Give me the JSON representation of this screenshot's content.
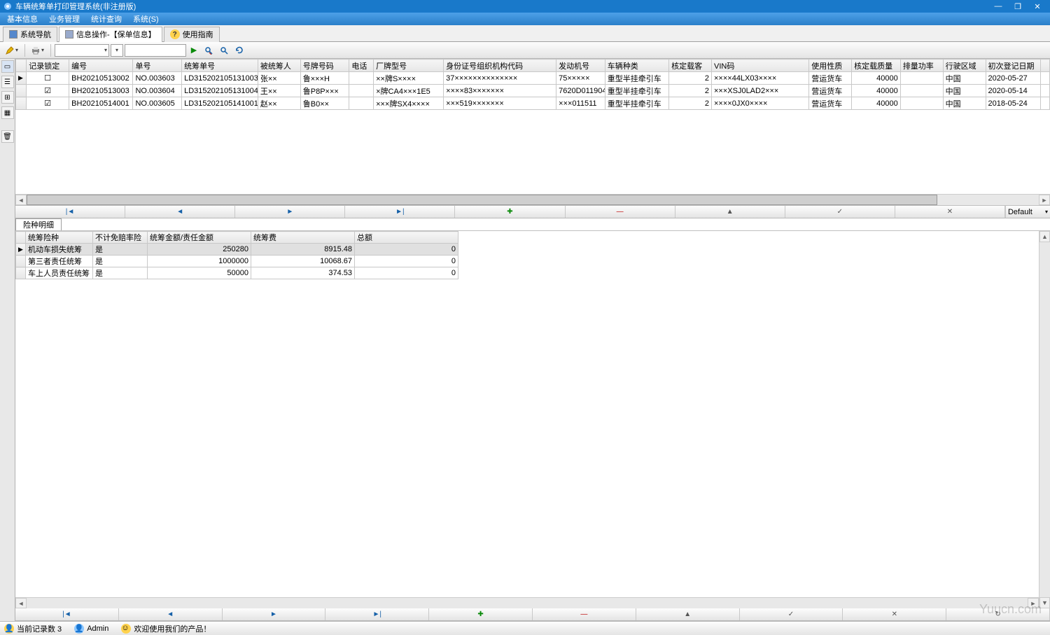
{
  "title": "车辆统筹单打印管理系统(非注册版)",
  "menu": [
    "基本信息",
    "业务管理",
    "统计查询",
    "系统(S)"
  ],
  "tabs": {
    "nav": "系统导航",
    "active": "信息操作-【保单信息】",
    "guide": "使用指南"
  },
  "toolbar": {
    "combo_text": "",
    "search_text": ""
  },
  "main_grid": {
    "columns": [
      "记录锁定",
      "编号",
      "单号",
      "统筹单号",
      "被统筹人",
      "号牌号码",
      "电话",
      "厂牌型号",
      "身份证号组织机构代码",
      "发动机号",
      "车辆种类",
      "核定载客",
      "VIN码",
      "使用性质",
      "核定载质量",
      "排量功率",
      "行驶区域",
      "初次登记日期"
    ],
    "rows": [
      {
        "lock": false,
        "no": "BH20210513002",
        "dan": "NO.003603",
        "tch": "LD315202105131003",
        "name": "张××",
        "plate": "鲁×××H",
        "phone": "",
        "model": "××牌S××××",
        "id": "37××××××××××××××",
        "eng": "75×××××",
        "type": "重型半挂牵引车",
        "seats": "2",
        "vin": "××××44LX03××××",
        "use": "营运货车",
        "mass": "40000",
        "power": "",
        "area": "中国",
        "date": "2020-05-27"
      },
      {
        "lock": true,
        "no": "BH20210513003",
        "dan": "NO.003604",
        "tch": "LD315202105131004",
        "name": "王××",
        "plate": "鲁P8P×××",
        "phone": "",
        "model": "×牌CA4×××1E5",
        "id": "××××83×××××××",
        "eng": "7620D011904",
        "type": "重型半挂牵引车",
        "seats": "2",
        "vin": "×××XSJ0LAD2×××",
        "use": "营运货车",
        "mass": "40000",
        "power": "",
        "area": "中国",
        "date": "2020-05-14"
      },
      {
        "lock": true,
        "no": "BH20210514001",
        "dan": "NO.003605",
        "tch": "LD315202105141001",
        "name": "赵××",
        "plate": "鲁B0××",
        "phone": "",
        "model": "×××牌SX4××××",
        "id": "×××519×××××××",
        "eng": "×××011511",
        "type": "重型半挂牵引车",
        "seats": "2",
        "vin": "××××0JX0××××",
        "use": "营运货车",
        "mass": "40000",
        "power": "",
        "area": "中国",
        "date": "2018-05-24"
      }
    ]
  },
  "nav_default": "Default",
  "detail_tab": "险种明细",
  "detail_grid": {
    "columns": [
      "统筹险种",
      "不计免赔率险",
      "统筹金额/责任金额",
      "统筹费",
      "总额"
    ],
    "rows": [
      {
        "kind": "机动车损失统筹",
        "nodeduct": "是",
        "amount": "250280",
        "fee": "8915.48",
        "total": "0"
      },
      {
        "kind": "第三者责任统筹",
        "nodeduct": "是",
        "amount": "1000000",
        "fee": "10068.67",
        "total": "0"
      },
      {
        "kind": "车上人员责任统筹",
        "nodeduct": "是",
        "amount": "50000",
        "fee": "374.53",
        "total": "0"
      }
    ]
  },
  "status": {
    "records": "当前记录数 3",
    "user": "Admin",
    "welcome": "欢迎使用我们的产品！"
  },
  "watermark": "Yuucn.com"
}
